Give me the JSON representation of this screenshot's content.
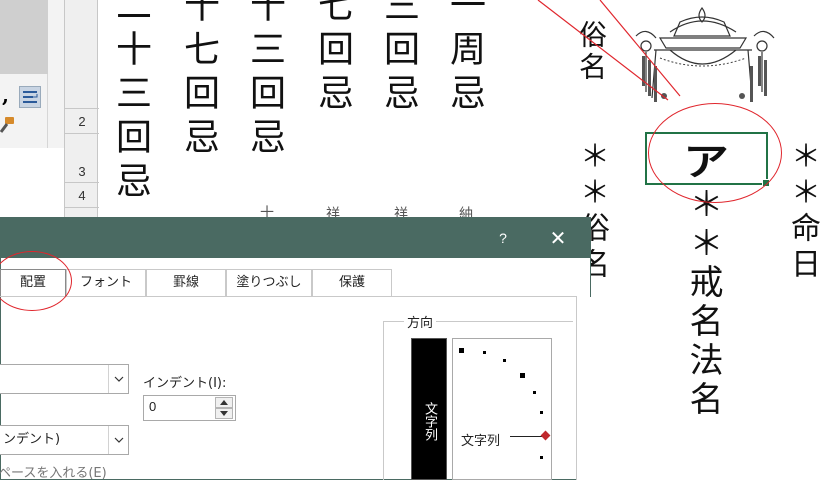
{
  "spreadsheet": {
    "row_numbers": [
      "2",
      "3",
      "4"
    ],
    "columns": [
      {
        "id": "c1",
        "text": "二十三回忌"
      },
      {
        "id": "c2",
        "text": "十七回忌"
      },
      {
        "id": "c3",
        "text": "十三回忌"
      },
      {
        "id": "c4",
        "text": "七回忌"
      },
      {
        "id": "c5",
        "text": "三回忌"
      },
      {
        "id": "c6",
        "text": "一周忌"
      }
    ],
    "behind_dialog": [
      "十",
      "祥",
      "祥",
      "紬"
    ],
    "zokumyo_label": "俗名",
    "zokumyo_value": "＊＊俗名",
    "kaimyo_value": "＊＊戒名法名",
    "meinichi_value": "＊＊命日",
    "selected_cell_text": "ア"
  },
  "dialog": {
    "help": "?",
    "close": "✕",
    "tabs": [
      {
        "label": "配置",
        "active": true
      },
      {
        "label": "フォント",
        "active": false
      },
      {
        "label": "罫線",
        "active": false
      },
      {
        "label": "塗りつぶし",
        "active": false
      },
      {
        "label": "保護",
        "active": false
      }
    ],
    "indent_label": "インデント(I):",
    "indent_value": "0",
    "combo2_text": "ンデント)",
    "space_label": "ペースを入れる(E)",
    "direction_label": "方向",
    "vertical_text": "文字列",
    "orient_label": "文字列"
  },
  "colors": {
    "dialog_title_bar": "#4a6a62",
    "selection": "#217346",
    "annotation_red": "#e0262d"
  }
}
